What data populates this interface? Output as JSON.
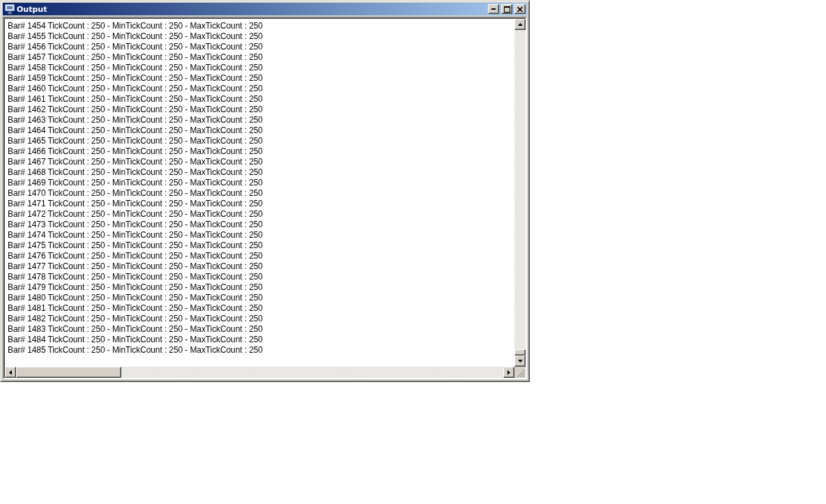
{
  "window": {
    "title": "Output"
  },
  "lines": [
    "Bar# 1454 TickCount : 250 - MinTickCount : 250 - MaxTickCount : 250",
    "Bar# 1455 TickCount : 250 - MinTickCount : 250 - MaxTickCount : 250",
    "Bar# 1456 TickCount : 250 - MinTickCount : 250 - MaxTickCount : 250",
    "Bar# 1457 TickCount : 250 - MinTickCount : 250 - MaxTickCount : 250",
    "Bar# 1458 TickCount : 250 - MinTickCount : 250 - MaxTickCount : 250",
    "Bar# 1459 TickCount : 250 - MinTickCount : 250 - MaxTickCount : 250",
    "Bar# 1460 TickCount : 250 - MinTickCount : 250 - MaxTickCount : 250",
    "Bar# 1461 TickCount : 250 - MinTickCount : 250 - MaxTickCount : 250",
    "Bar# 1462 TickCount : 250 - MinTickCount : 250 - MaxTickCount : 250",
    "Bar# 1463 TickCount : 250 - MinTickCount : 250 - MaxTickCount : 250",
    "Bar# 1464 TickCount : 250 - MinTickCount : 250 - MaxTickCount : 250",
    "Bar# 1465 TickCount : 250 - MinTickCount : 250 - MaxTickCount : 250",
    "Bar# 1466 TickCount : 250 - MinTickCount : 250 - MaxTickCount : 250",
    "Bar# 1467 TickCount : 250 - MinTickCount : 250 - MaxTickCount : 250",
    "Bar# 1468 TickCount : 250 - MinTickCount : 250 - MaxTickCount : 250",
    "Bar# 1469 TickCount : 250 - MinTickCount : 250 - MaxTickCount : 250",
    "Bar# 1470 TickCount : 250 - MinTickCount : 250 - MaxTickCount : 250",
    "Bar# 1471 TickCount : 250 - MinTickCount : 250 - MaxTickCount : 250",
    "Bar# 1472 TickCount : 250 - MinTickCount : 250 - MaxTickCount : 250",
    "Bar# 1473 TickCount : 250 - MinTickCount : 250 - MaxTickCount : 250",
    "Bar# 1474 TickCount : 250 - MinTickCount : 250 - MaxTickCount : 250",
    "Bar# 1475 TickCount : 250 - MinTickCount : 250 - MaxTickCount : 250",
    "Bar# 1476 TickCount : 250 - MinTickCount : 250 - MaxTickCount : 250",
    "Bar# 1477 TickCount : 250 - MinTickCount : 250 - MaxTickCount : 250",
    "Bar# 1478 TickCount : 250 - MinTickCount : 250 - MaxTickCount : 250",
    "Bar# 1479 TickCount : 250 - MinTickCount : 250 - MaxTickCount : 250",
    "Bar# 1480 TickCount : 250 - MinTickCount : 250 - MaxTickCount : 250",
    "Bar# 1481 TickCount : 250 - MinTickCount : 250 - MaxTickCount : 250",
    "Bar# 1482 TickCount : 250 - MinTickCount : 250 - MaxTickCount : 250",
    "Bar# 1483 TickCount : 250 - MinTickCount : 250 - MaxTickCount : 250",
    "Bar# 1484 TickCount : 250 - MinTickCount : 250 - MaxTickCount : 250",
    "Bar# 1485 TickCount : 250 - MinTickCount : 250 - MaxTickCount : 250"
  ]
}
